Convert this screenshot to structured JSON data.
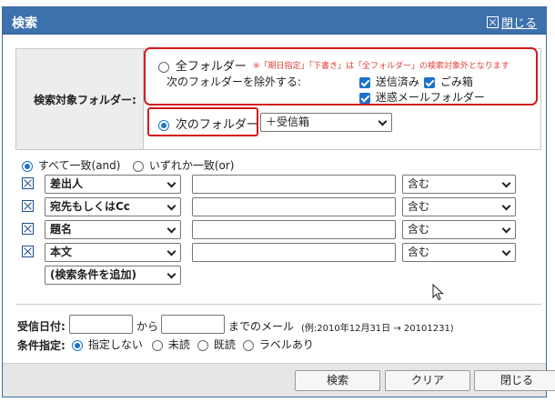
{
  "dialog": {
    "title": "検索",
    "close_label": "閉じる"
  },
  "target": {
    "label": "検索対象フォルダー:",
    "all_folders": "全フォルダー",
    "note": "※「期日指定」「下書き」は「全フォルダー」の検索対象外となります",
    "exclude_label": "次のフォルダーを除外する:",
    "exclude_sent": "送信済み",
    "exclude_trash": "ごみ箱",
    "exclude_spam": "迷惑メールフォルダー",
    "next_folder": "次のフォルダー",
    "folder_select": "＋受信箱"
  },
  "match": {
    "all": "すべて一致(and)",
    "any": "いずれか一致(or)"
  },
  "conditions": [
    {
      "field": "差出人",
      "value": "",
      "operator": "含む"
    },
    {
      "field": "宛先もしくはCc",
      "value": "",
      "operator": "含む"
    },
    {
      "field": "題名",
      "value": "",
      "operator": "含む"
    },
    {
      "field": "本文",
      "value": "",
      "operator": "含む"
    }
  ],
  "add_condition": "(検索条件を追加)",
  "date": {
    "label": "受信日付:",
    "from": "から",
    "to_text": "までのメール",
    "example": "(例:2010年12月31日 → 20101231)"
  },
  "condition_spec": {
    "label": "条件指定:",
    "none": "指定しない",
    "unread": "未読",
    "read": "既読",
    "labeled": "ラベルあり"
  },
  "buttons": {
    "search": "検索",
    "clear": "クリア",
    "close": "閉じる"
  },
  "colors": {
    "titlebar": "#3c71ad",
    "accent": "#1a73c9",
    "highlight_box": "#d21b1b",
    "note_text": "#e0403a"
  }
}
